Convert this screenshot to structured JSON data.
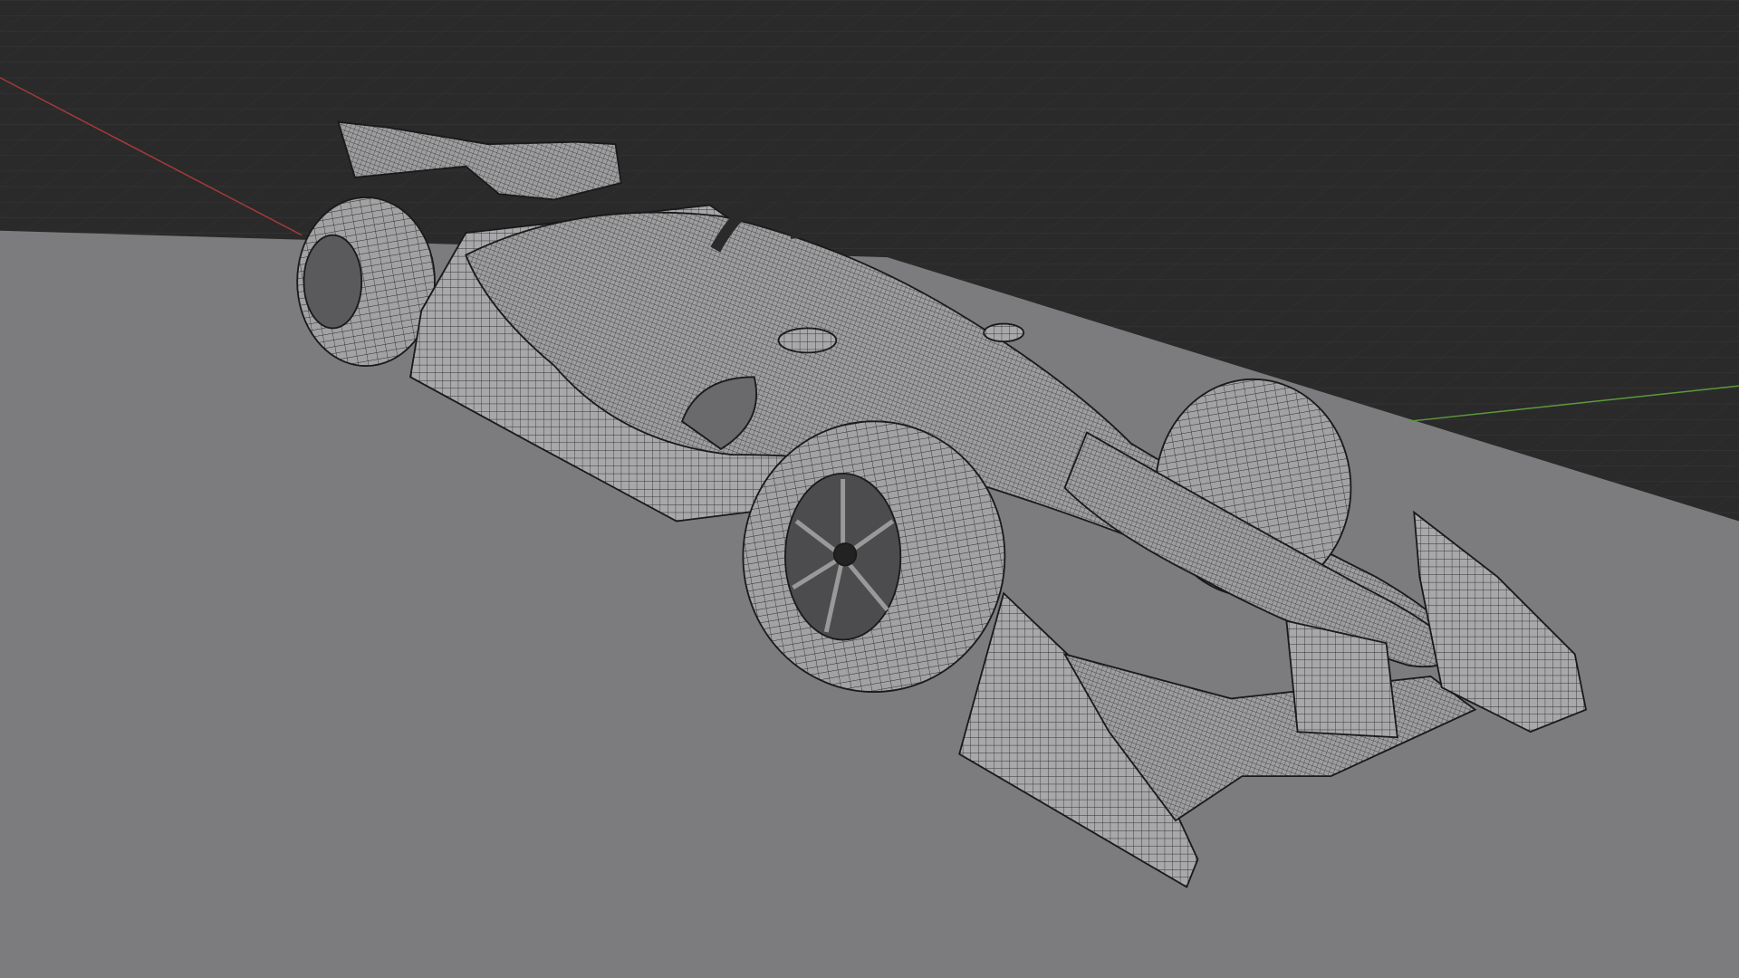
{
  "viewport": {
    "mode": "wireframe-overlay",
    "background_color": "#2a2a2a",
    "grid_color": "#3a3a3a",
    "floor_color": "#7c7c7e",
    "x_axis_color": "#a83a3a",
    "y_axis_color": "#5c9a3c",
    "mesh_surface_color": "#a9a9ab",
    "wire_color": "#2a2a2a"
  },
  "object": {
    "type": "formula-car-mesh"
  }
}
